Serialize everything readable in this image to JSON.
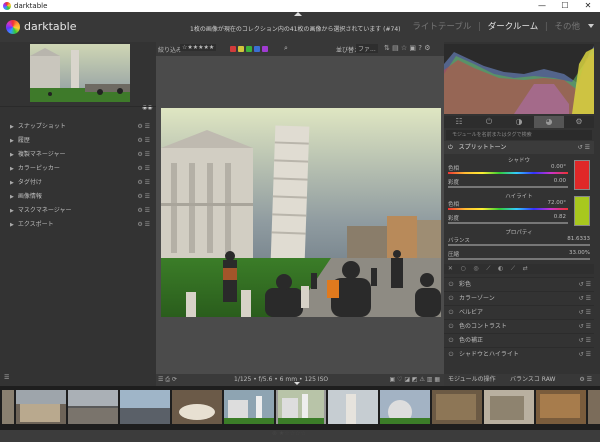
{
  "window": {
    "title": "darktable",
    "minimize": "—",
    "maximize": "☐",
    "close": "✕"
  },
  "header": {
    "logo_text": "darktable",
    "message": "1枚の画像が現在のコレクション内の41枚の画像から選択されています (#74)",
    "views": [
      "ライトテーブル",
      "ダークルーム",
      "その他"
    ],
    "active_view": "ダークルーム",
    "menu_icon": "triangle-down-icon"
  },
  "left_panel": {
    "modules": [
      "スナップショット",
      "履歴",
      "複製マネージャー",
      "カラーピッカー",
      "タグ付け",
      "画像情報",
      "マスクマネージャー",
      "エクスポート"
    ]
  },
  "filterbar": {
    "label": "絞り込み",
    "rating": "☆★★★★★",
    "sort_label": "並び替え",
    "sort_value": "ファ...",
    "color_labels": [
      "#d23b3b",
      "#d2c43b",
      "#3bb23b",
      "#3b6fd2",
      "#a03bd2"
    ]
  },
  "photo_info": {
    "text": "1/125 • f/5.6 • 6 mm • 125 ISO"
  },
  "right_panel": {
    "tabs": [
      "quick-access-icon",
      "power-icon",
      "play-icon",
      "color-circle-icon",
      "gear-icon"
    ],
    "search_placeholder": "モジュールを名前またはタグで検索",
    "module_title": "スプリットトーン",
    "shadows_label": "シャドウ",
    "hue_label": "色相",
    "hue_shadow_value": "0.00°",
    "saturation_label": "彩度",
    "sat_shadow_value": "0.00",
    "highlights_label": "ハイライト",
    "hue_highlight_value": "72.00°",
    "sat_highlight_value": "0.82",
    "proportion_label": "プロパティ",
    "balance_label": "バランス",
    "balance_value": "81.6333",
    "compress_label": "圧縮",
    "compress_value": "33.00%",
    "shadow_swatch": "#e02828",
    "highlight_swatch": "#a8c81e",
    "module_list": [
      "彩色",
      "カラーゾーン",
      "ベルビア",
      "色のコントラスト",
      "色の補正",
      "シャドウとハイライト"
    ],
    "footer_left": "モジュールの操作",
    "footer_preset": "バランスコ RAW"
  },
  "filmstrip": {
    "rating": "⊗ ★☆☆☆☆"
  }
}
